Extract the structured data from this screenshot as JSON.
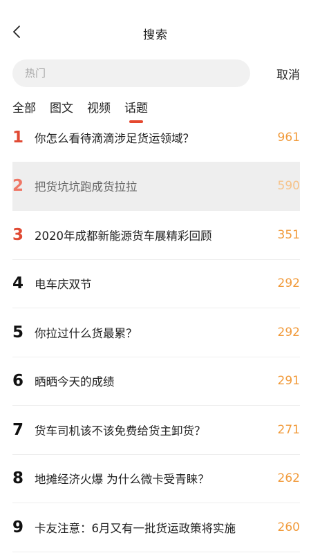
{
  "header": {
    "title": "搜索"
  },
  "search": {
    "placeholder": "热门",
    "cancel_label": "取消"
  },
  "tabs": [
    {
      "label": "全部",
      "active": false
    },
    {
      "label": "图文",
      "active": false
    },
    {
      "label": "视频",
      "active": false
    },
    {
      "label": "话题",
      "active": true
    }
  ],
  "topics": [
    {
      "rank": "1",
      "title": "你怎么看待滴滴涉足货运领域？",
      "count": "961"
    },
    {
      "rank": "2",
      "title": "把货坑坑跑成货拉拉",
      "count": "590"
    },
    {
      "rank": "3",
      "title": "2020年成都新能源货车展精彩回顾",
      "count": "351"
    },
    {
      "rank": "4",
      "title": "电车庆双节",
      "count": "292"
    },
    {
      "rank": "5",
      "title": "你拉过什么货最累？",
      "count": "292"
    },
    {
      "rank": "6",
      "title": "晒晒今天的成绩",
      "count": "291"
    },
    {
      "rank": "7",
      "title": "货车司机该不该免费给货主卸货？",
      "count": "271"
    },
    {
      "rank": "8",
      "title": "地摊经济火爆 为什么微卡受青睐？",
      "count": "262"
    },
    {
      "rank": "9",
      "title": "卡友注意：6月又有一批货运政策将实施",
      "count": "260"
    }
  ],
  "colors": {
    "accent": "#e5482f",
    "count": "#f19a3a",
    "highlight_bg": "#eeeeee"
  }
}
